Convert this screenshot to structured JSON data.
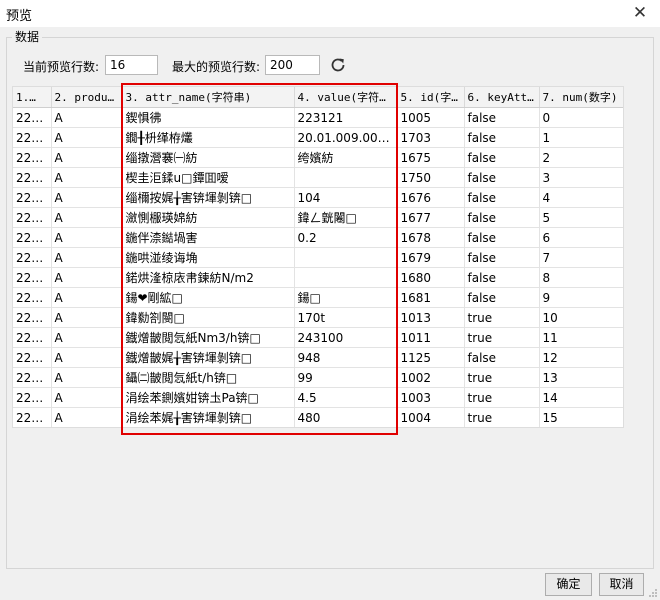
{
  "window": {
    "title": "预览",
    "close_icon": "close-icon"
  },
  "group": {
    "legend": "数据"
  },
  "controls": {
    "current_rows_label": "当前预览行数:",
    "current_rows_value": "16",
    "max_rows_label": "最大的预览行数:",
    "max_rows_value": "200",
    "refresh_icon": "refresh-icon"
  },
  "table": {
    "columns": [
      "1.…",
      "2. produc…",
      "3. attr_name(字符串)",
      "4. value(字符串)",
      "5. id(字…",
      "6. keyAtt…",
      "7. num(数字)"
    ],
    "rows": [
      [
        "223…",
        "A",
        "鍥惧彿",
        "223121",
        "1005",
        "false",
        "0"
      ],
      [
        "223…",
        "A",
        "鐗╂枡缂栫爜",
        "20.01.009.0000…",
        "1703",
        "false",
        "1"
      ],
      [
        "223…",
        "A",
        "缁撴瀯褰㈠紡",
        "绔嬪紡",
        "1675",
        "false",
        "2"
      ],
      [
        "223…",
        "A",
        "楔圭洰鍒u□鐔囬嗳",
        "",
        "1750",
        "false",
        "3"
      ],
      [
        "223…",
        "A",
        "缁檷按娓╁害锛堚剝锛□",
        "104",
        "1676",
        "false",
        "4"
      ],
      [
        "223…",
        "A",
        "瀲惻棴瑛婂紡",
        "鍏ㄥ皝闂□",
        "1677",
        "false",
        "5"
      ],
      [
        "223…",
        "A",
        "鍦伴渿鐑堝害",
        "0.2",
        "1678",
        "false",
        "6"
      ],
      [
        "223…",
        "A",
        "鍦哄湴绫诲埆",
        "",
        "1679",
        "false",
        "7"
      ],
      [
        "223…",
        "A",
        "鍩烘湰椋庡帇鍊紡N/m2",
        "",
        "1680",
        "false",
        "8"
      ],
      [
        "223…",
        "A",
        "鍚❤剛絋□",
        "鍚□",
        "1681",
        "false",
        "9"
      ],
      [
        "223…",
        "A",
        "鍏勬劄閿□",
        "170t",
        "1013",
        "true",
        "10"
      ],
      [
        "223…",
        "A",
        "鐡熷皵閲忥紙Nm3/h锛□",
        "243100",
        "1011",
        "true",
        "11"
      ],
      [
        "223…",
        "A",
        "鐡熷皵娓╁害锛堚剝锛□",
        "948",
        "1125",
        "false",
        "12"
      ],
      [
        "223…",
        "A",
        "鑷㈡皵閲忥紙t/h锛□",
        "99",
        "1002",
        "true",
        "13"
      ],
      [
        "223…",
        "A",
        "涓绘苯鍘嬪姏锛圡Pa锛□",
        "4.5",
        "1003",
        "true",
        "14"
      ],
      [
        "223…",
        "A",
        "涓绘苯娓╁害锛堚剝锛□",
        "480",
        "1004",
        "true",
        "15"
      ]
    ]
  },
  "buttons": {
    "ok": "确定",
    "cancel": "取消"
  },
  "colors": {
    "highlight_border": "#e00000",
    "dialog_bg": "#f0f0f0"
  }
}
